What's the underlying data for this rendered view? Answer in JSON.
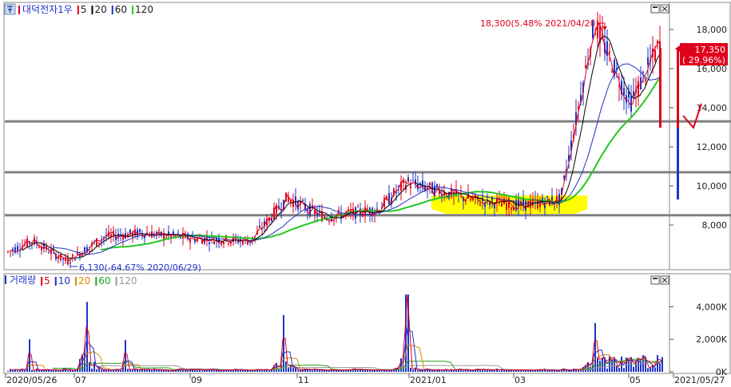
{
  "price_panel": {
    "legend": {
      "icon": "pin-icon",
      "name": "대덕전자1우",
      "ma": [
        {
          "label": "5",
          "color": "#e0001b"
        },
        {
          "label": "20",
          "color": "#000000"
        },
        {
          "label": "60",
          "color": "#1f33c8"
        },
        {
          "label": "120",
          "color": "#22c822"
        }
      ]
    },
    "high_annotation": "18,300(5.48% 2021/04/20)",
    "low_annotation": "6,130(-64.67% 2020/06/29)",
    "current_price": "17,350",
    "current_change": "( 29.96%)",
    "yticks": [
      "8,000",
      "10,000",
      "12,000",
      "14,000",
      "16,000",
      "18,000"
    ],
    "yrange": [
      5800,
      19300
    ]
  },
  "volume_panel": {
    "legend": {
      "name": "거래량",
      "ma": [
        {
          "label": "5",
          "color": "#e0001b"
        },
        {
          "label": "10",
          "color": "#1f33c8"
        },
        {
          "label": "20",
          "color": "#e08a00"
        },
        {
          "label": "60",
          "color": "#22a022"
        },
        {
          "label": "120",
          "color": "#9a9a9a"
        }
      ]
    },
    "yticks": [
      "0K",
      "2,000K",
      "4,000K"
    ],
    "yrange": [
      0,
      5200
    ]
  },
  "x_axis": {
    "labels": [
      "2020/05/26",
      "07",
      "09",
      "11",
      "2021/01",
      "03",
      "05",
      "2021/05/27"
    ]
  },
  "colors": {
    "up": "#e0001b",
    "down": "#1f33c8",
    "ma5": "#e0001b",
    "ma20": "#000000",
    "ma60": "#1f33c8",
    "ma120": "#22c822",
    "highlight": "#ffff00"
  },
  "chart_data": {
    "type": "candlestick",
    "x_range": [
      "2020/05/26",
      "2021/05/27"
    ],
    "horizontal_levels": [
      8500,
      10700,
      13300
    ],
    "price_path": [
      {
        "date": "2020/05/26",
        "close": 6600
      },
      {
        "date": "2020/06/10",
        "close": 7200
      },
      {
        "date": "2020/06/29",
        "close": 6130
      },
      {
        "date": "2020/07/20",
        "close": 7400
      },
      {
        "date": "2020/08/10",
        "close": 7600
      },
      {
        "date": "2020/09/10",
        "close": 7300
      },
      {
        "date": "2020/10/10",
        "close": 7200
      },
      {
        "date": "2020/10/30",
        "close": 9400
      },
      {
        "date": "2020/11/20",
        "close": 8400
      },
      {
        "date": "2020/12/20",
        "close": 8800
      },
      {
        "date": "2021/01/05",
        "close": 10200
      },
      {
        "date": "2021/02/10",
        "close": 9300
      },
      {
        "date": "2021/03/10",
        "close": 9000
      },
      {
        "date": "2021/04/01",
        "close": 9300
      },
      {
        "date": "2021/04/20",
        "close": 18300
      },
      {
        "date": "2021/05/10",
        "close": 14200
      },
      {
        "date": "2021/05/27",
        "close": 17350
      }
    ],
    "volume_path": [
      {
        "date": "2020/06/08",
        "volume": 2000
      },
      {
        "date": "2020/07/10",
        "volume": 4300
      },
      {
        "date": "2020/08/01",
        "volume": 1950
      },
      {
        "date": "2020/10/28",
        "volume": 3500
      },
      {
        "date": "2021/01/05",
        "volume": 4750
      },
      {
        "date": "2021/04/20",
        "volume": 3000
      },
      {
        "date": "2021/05/27",
        "volume": 450
      }
    ]
  }
}
